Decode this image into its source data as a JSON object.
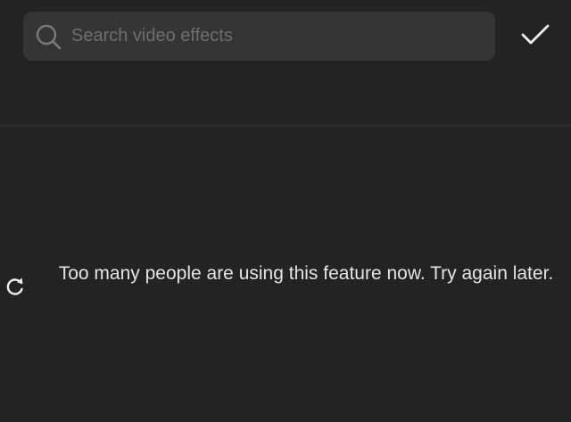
{
  "search": {
    "placeholder": "Search video effects",
    "value": "",
    "icon": "search-icon"
  },
  "toolbar": {
    "confirm_icon": "checkmark-icon"
  },
  "status": {
    "retry_icon": "refresh-icon",
    "message": "Too many people are using this feature now. Try again later."
  },
  "colors": {
    "background": "#232323",
    "search_background": "#353535",
    "placeholder": "#6e6e6e",
    "text": "#e4e4e4",
    "divider": "#3a3a3a"
  }
}
